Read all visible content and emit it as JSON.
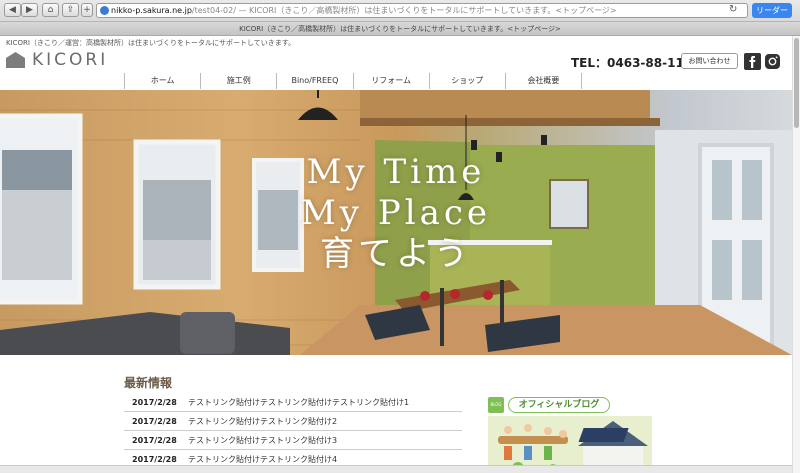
{
  "browser": {
    "url_host": "nikko-p.sakura.ne.jp",
    "url_rest": "/test04-02/ — KICORI（きこり／高橋製材所）は住まいづくりをトータルにサポートしていきます。<トップページ>",
    "reader_label": "リーダー",
    "tab_title": "KICORI（きこり／高橋製材所）は住まいづくりをトータルにサポートしていきます。<トップページ>"
  },
  "header": {
    "tagline": "KICORI（きこり／運営：高橋製材所）は住まいづくりをトータルにサポートしていきます。",
    "logo_text": "KICORI",
    "tel": "TEL：0463-88-1118",
    "contact_label": "お問い合わせ"
  },
  "nav": {
    "items": [
      "ホーム",
      "施工例",
      "Bino/FREEQ",
      "リフォーム",
      "ショップ",
      "会社概要"
    ]
  },
  "hero": {
    "lines": [
      "My Time",
      "My Place",
      "育てよう"
    ]
  },
  "news": {
    "title": "最新情報",
    "items": [
      {
        "date": "2017/2/28",
        "text": "テストリンク貼付けテストリンク貼付けテストリンク貼付け1"
      },
      {
        "date": "2017/2/28",
        "text": "テストリンク貼付けテストリンク貼付け2"
      },
      {
        "date": "2017/2/28",
        "text": "テストリンク貼付けテストリンク貼付け3"
      },
      {
        "date": "2017/2/28",
        "text": "テストリンク貼付けテストリンク貼付け4"
      }
    ]
  },
  "blog": {
    "badge": "BLOG",
    "label": "オフィシャルブログ"
  },
  "colors": {
    "accent_green": "#7fbf55",
    "reader_blue": "#3a86f0",
    "news_title": "#6b5c4a"
  },
  "icons": {
    "facebook": "facebook-icon",
    "instagram": "instagram-icon",
    "globe": "globe-icon"
  }
}
